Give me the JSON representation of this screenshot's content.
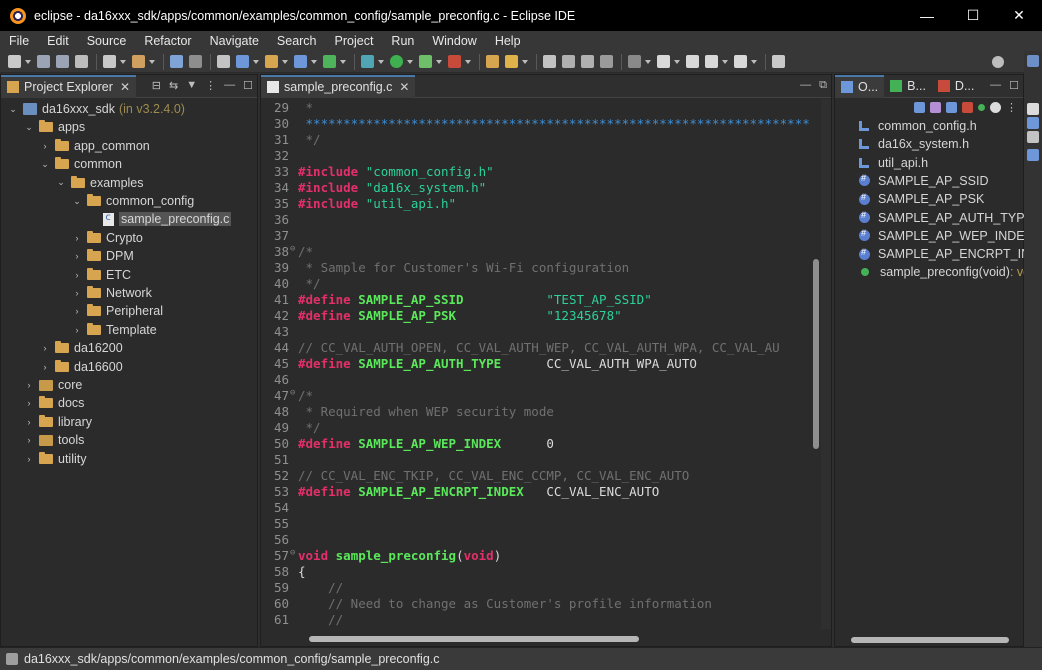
{
  "window": {
    "title": "eclipse - da16xxx_sdk/apps/common/examples/common_config/sample_preconfig.c - Eclipse IDE",
    "minimize": "—",
    "maximize": "☐",
    "close": "✕"
  },
  "menu": [
    "File",
    "Edit",
    "Source",
    "Refactor",
    "Navigate",
    "Search",
    "Project",
    "Run",
    "Window",
    "Help"
  ],
  "explorer": {
    "tab_label": "Project Explorer",
    "tree": [
      {
        "label": "da16xxx_sdk",
        "decor": "(in v3.2.4.0)",
        "kind": "project",
        "expanded": true
      },
      {
        "label": "apps",
        "kind": "folder",
        "expanded": true
      },
      {
        "label": "app_common",
        "kind": "folder",
        "expanded": false
      },
      {
        "label": "common",
        "kind": "folder",
        "expanded": true
      },
      {
        "label": "examples",
        "kind": "folder",
        "expanded": true
      },
      {
        "label": "common_config",
        "kind": "folder",
        "expanded": true
      },
      {
        "label": "sample_preconfig.c",
        "kind": "file",
        "selected": true
      },
      {
        "label": "Crypto",
        "kind": "folder",
        "expanded": false
      },
      {
        "label": "DPM",
        "kind": "folder",
        "expanded": false
      },
      {
        "label": "ETC",
        "kind": "folder",
        "expanded": false
      },
      {
        "label": "Network",
        "kind": "folder",
        "expanded": false
      },
      {
        "label": "Peripheral",
        "kind": "folder",
        "expanded": false
      },
      {
        "label": "Template",
        "kind": "folder",
        "expanded": false
      },
      {
        "label": "da16200",
        "kind": "folder",
        "expanded": false
      },
      {
        "label": "da16600",
        "kind": "folder",
        "expanded": false
      },
      {
        "label": "core",
        "kind": "pkg",
        "expanded": false
      },
      {
        "label": "docs",
        "kind": "folder",
        "expanded": false
      },
      {
        "label": "library",
        "kind": "folder",
        "expanded": false
      },
      {
        "label": "tools",
        "kind": "pkg",
        "expanded": false
      },
      {
        "label": "utility",
        "kind": "folder",
        "expanded": false
      }
    ]
  },
  "editor": {
    "tab_label": "sample_preconfig.c",
    "lines": [
      {
        "n": "29",
        "parts": [
          [
            " *",
            "c-comment"
          ]
        ]
      },
      {
        "n": "30",
        "parts": [
          [
            " ******************************************************************************",
            "c-star"
          ]
        ]
      },
      {
        "n": "31",
        "parts": [
          [
            " */",
            "c-comment"
          ]
        ]
      },
      {
        "n": "32",
        "parts": []
      },
      {
        "n": "33",
        "parts": [
          [
            "#include ",
            "c-inc"
          ],
          [
            "\"common_config.h\"",
            "c-str"
          ]
        ]
      },
      {
        "n": "34",
        "parts": [
          [
            "#include ",
            "c-inc"
          ],
          [
            "\"da16x_system.h\"",
            "c-str"
          ]
        ]
      },
      {
        "n": "35",
        "parts": [
          [
            "#include ",
            "c-inc"
          ],
          [
            "\"util_api.h\"",
            "c-str"
          ]
        ]
      },
      {
        "n": "36",
        "parts": []
      },
      {
        "n": "37",
        "parts": []
      },
      {
        "n": "38",
        "fold": true,
        "parts": [
          [
            "/*",
            "c-comment"
          ]
        ]
      },
      {
        "n": "39",
        "parts": [
          [
            " * Sample for Customer's Wi-Fi configuration",
            "c-comment"
          ]
        ]
      },
      {
        "n": "40",
        "parts": [
          [
            " */",
            "c-comment"
          ]
        ]
      },
      {
        "n": "41",
        "parts": [
          [
            "#define ",
            "c-def"
          ],
          [
            "SAMPLE_AP_SSID",
            "c-macro"
          ],
          [
            "           ",
            "c-plain"
          ],
          [
            "\"TEST_AP_SSID\"",
            "c-str"
          ]
        ]
      },
      {
        "n": "42",
        "parts": [
          [
            "#define ",
            "c-def"
          ],
          [
            "SAMPLE_AP_PSK",
            "c-macro"
          ],
          [
            "            ",
            "c-plain"
          ],
          [
            "\"12345678\"",
            "c-str"
          ]
        ]
      },
      {
        "n": "43",
        "parts": []
      },
      {
        "n": "44",
        "parts": [
          [
            "// CC_VAL_AUTH_OPEN, CC_VAL_AUTH_WEP, CC_VAL_AUTH_WPA, CC_VAL_AU",
            "c-comment"
          ]
        ]
      },
      {
        "n": "45",
        "parts": [
          [
            "#define ",
            "c-def"
          ],
          [
            "SAMPLE_AP_AUTH_TYPE",
            "c-macro"
          ],
          [
            "      CC_VAL_AUTH_WPA_AUTO",
            "c-plain"
          ]
        ]
      },
      {
        "n": "46",
        "parts": []
      },
      {
        "n": "47",
        "fold": true,
        "parts": [
          [
            "/*",
            "c-comment"
          ]
        ]
      },
      {
        "n": "48",
        "parts": [
          [
            " * Required when WEP security mode",
            "c-comment"
          ]
        ]
      },
      {
        "n": "49",
        "parts": [
          [
            " */",
            "c-comment"
          ]
        ]
      },
      {
        "n": "50",
        "parts": [
          [
            "#define ",
            "c-def"
          ],
          [
            "SAMPLE_AP_WEP_INDEX",
            "c-macro"
          ],
          [
            "      0",
            "c-plain"
          ]
        ]
      },
      {
        "n": "51",
        "parts": []
      },
      {
        "n": "52",
        "parts": [
          [
            "// CC_VAL_ENC_TKIP, CC_VAL_ENC_CCMP, CC_VAL_ENC_AUTO",
            "c-comment"
          ]
        ]
      },
      {
        "n": "53",
        "parts": [
          [
            "#define ",
            "c-def"
          ],
          [
            "SAMPLE_AP_ENCRPT_INDEX",
            "c-macro"
          ],
          [
            "   CC_VAL_ENC_AUTO",
            "c-plain"
          ]
        ]
      },
      {
        "n": "54",
        "parts": []
      },
      {
        "n": "55",
        "parts": []
      },
      {
        "n": "56",
        "parts": []
      },
      {
        "n": "57",
        "fold": true,
        "parts": [
          [
            "void ",
            "c-kw"
          ],
          [
            "sample_preconfig",
            "c-fn"
          ],
          [
            "(",
            "c-plain"
          ],
          [
            "void",
            "c-kw"
          ],
          [
            ")",
            "c-plain"
          ]
        ]
      },
      {
        "n": "58",
        "parts": [
          [
            "{",
            "c-plain"
          ]
        ]
      },
      {
        "n": "59",
        "parts": [
          [
            "    //",
            "c-comment"
          ]
        ]
      },
      {
        "n": "60",
        "parts": [
          [
            "    // Need to change as Customer's profile information",
            "c-comment"
          ]
        ]
      },
      {
        "n": "61",
        "parts": [
          [
            "    //",
            "c-comment"
          ]
        ]
      }
    ]
  },
  "outline": {
    "tabs": [
      "O...",
      "B...",
      "D..."
    ],
    "items": [
      {
        "label": "common_config.h",
        "kind": "include"
      },
      {
        "label": "da16x_system.h",
        "kind": "include"
      },
      {
        "label": "util_api.h",
        "kind": "include"
      },
      {
        "label": "SAMPLE_AP_SSID",
        "kind": "macro"
      },
      {
        "label": "SAMPLE_AP_PSK",
        "kind": "macro"
      },
      {
        "label": "SAMPLE_AP_AUTH_TYPE",
        "kind": "macro"
      },
      {
        "label": "SAMPLE_AP_WEP_INDEX",
        "kind": "macro"
      },
      {
        "label": "SAMPLE_AP_ENCRPT_INDEX",
        "kind": "macro"
      },
      {
        "label": "sample_preconfig(void)",
        "type_suffix": " : vo",
        "kind": "function"
      }
    ]
  },
  "statusbar": {
    "path": "da16xxx_sdk/apps/common/examples/common_config/sample_preconfig.c"
  },
  "colors": {
    "accent": "#4a78a8",
    "keyword": "#e3306b",
    "macro": "#5ae85a",
    "string": "#2dd19a",
    "comment": "#707070"
  }
}
